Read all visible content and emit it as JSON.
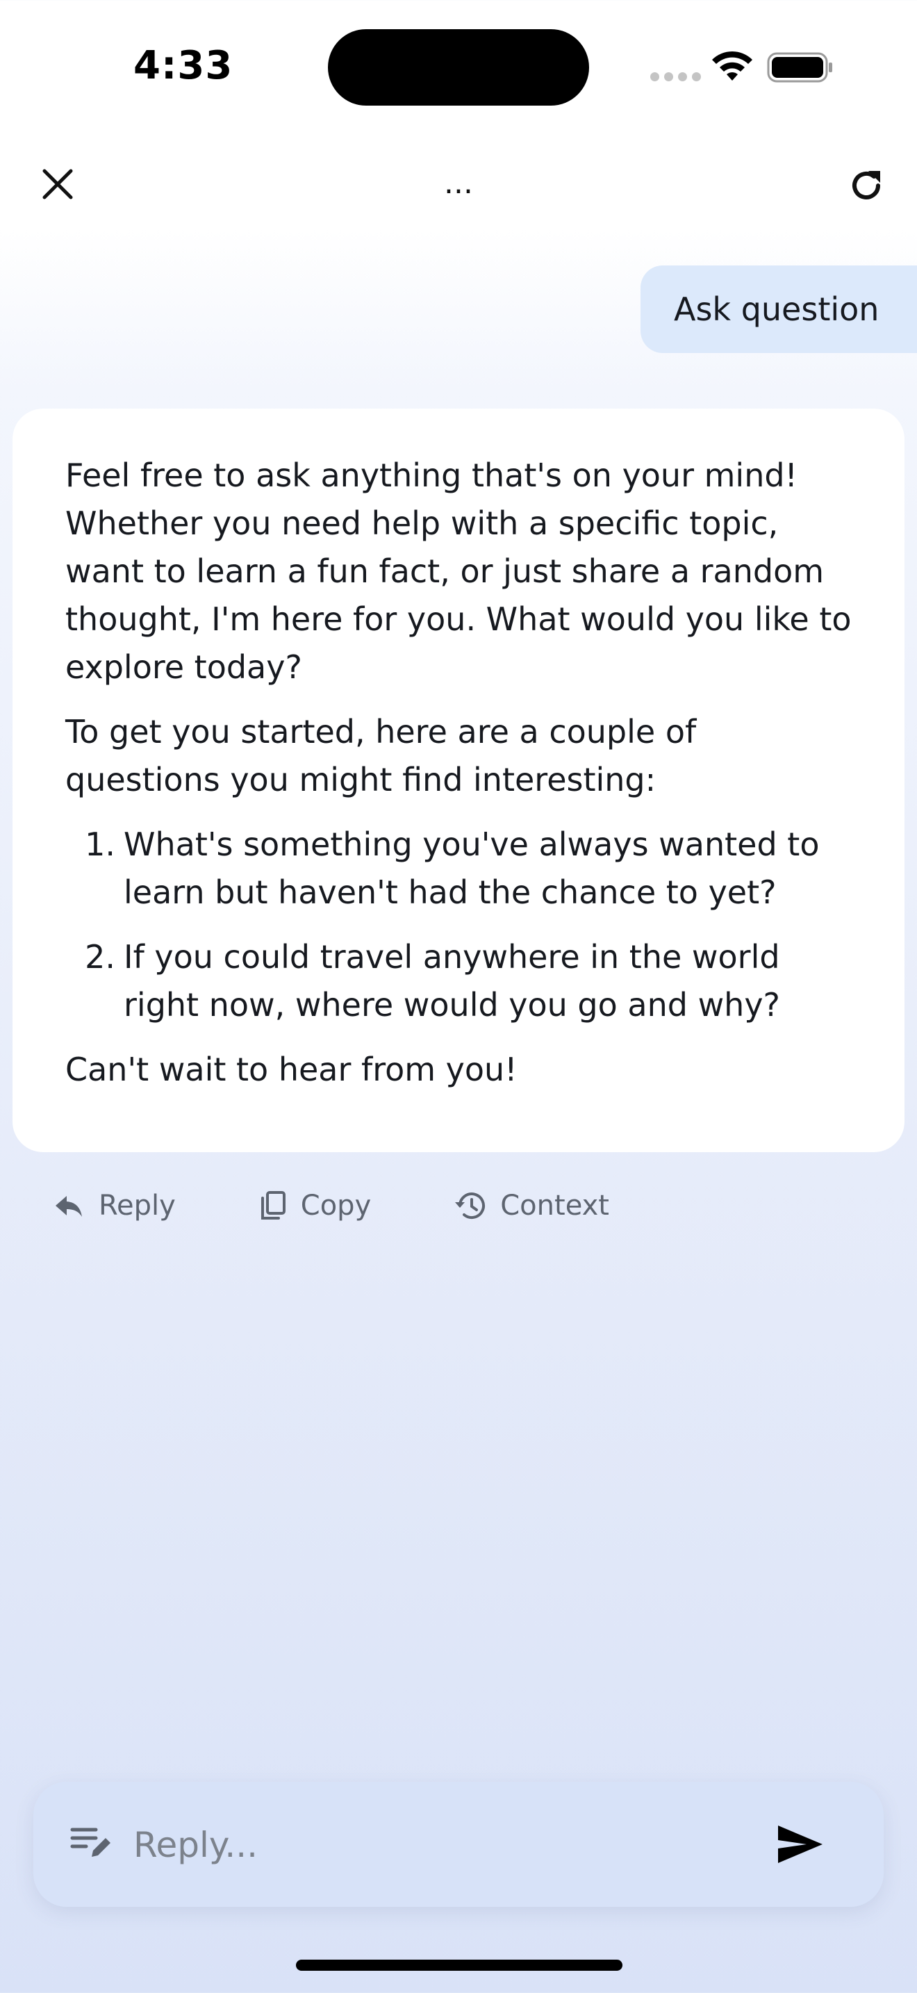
{
  "status_bar": {
    "time": "4:33"
  },
  "top_bar": {
    "title": "..."
  },
  "user_message": {
    "text": "Ask question"
  },
  "assistant_message": {
    "paragraph_1": "Feel free to ask anything that's on your mind! Whether you need help with a specific topic, want to learn a fun fact, or just share a random thought, I'm here for you. What would you like to explore today?",
    "paragraph_2": "To get you started, here are a couple of questions you might find interesting:",
    "list": [
      {
        "number": "1.",
        "text": "What's something you've always wanted to learn but haven't had the chance to yet?"
      },
      {
        "number": "2.",
        "text": "If you could travel anywhere in the world right now, where would you go and why?"
      }
    ],
    "closing": "Can't wait to hear from you!"
  },
  "actions": {
    "reply_label": "Reply",
    "copy_label": "Copy",
    "context_label": "Context"
  },
  "composer": {
    "placeholder": "Reply...",
    "value": ""
  },
  "icons": {
    "close": "close-icon",
    "refresh": "refresh-icon",
    "reply": "reply-arrow-icon",
    "copy": "copy-icon",
    "context": "history-icon",
    "edit": "edit-note-icon",
    "send": "send-icon",
    "wifi": "wifi-icon",
    "battery": "battery-icon"
  },
  "colors": {
    "user_bubble": "#dce9fb",
    "composer_bg": "#d7e2f8",
    "action_text": "#5d6470"
  }
}
